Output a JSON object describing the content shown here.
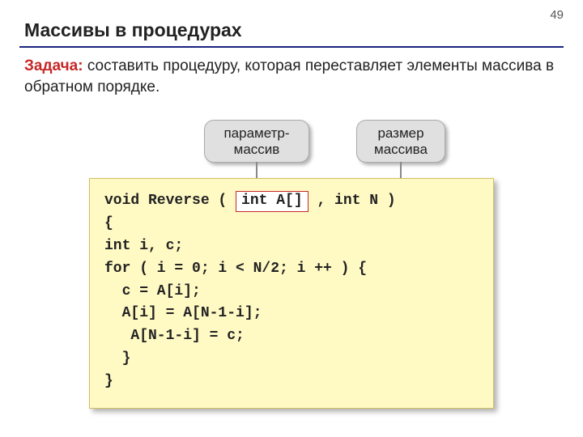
{
  "page_number": "49",
  "title": "Массивы в процедурах",
  "task_label": "Задача:",
  "task_text": " составить процедуру, которая переставляет элементы массива в обратном порядке.",
  "callouts": {
    "left": "параметр-\nмассив",
    "right": "размер\nмассива"
  },
  "code": {
    "sig_pre": "void Reverse ( ",
    "sig_hl": "int A[]",
    "sig_post": " , int N )",
    "l1": "{",
    "l2": "int i, c;",
    "l3": "for ( i = 0; i < N/2; i ++ ) {",
    "l4": "  c = A[i];",
    "l5": "  A[i] = A[N-1-i];",
    "l6": "   A[N-1-i] = c;",
    "l7": "  }",
    "l8": "}"
  }
}
